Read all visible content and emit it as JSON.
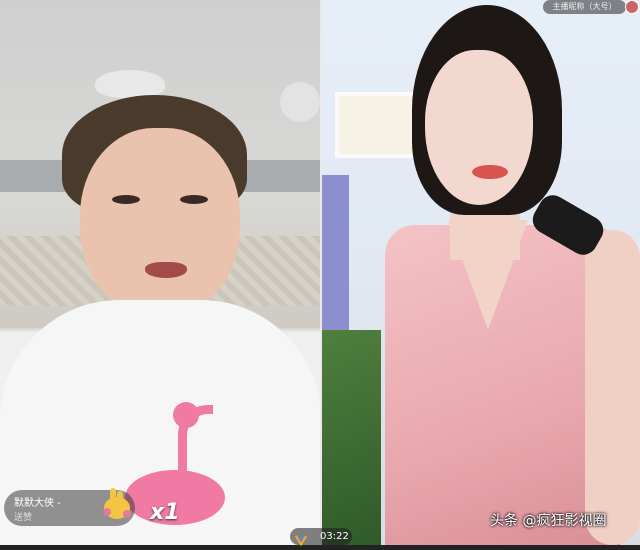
{
  "top_right_tag": "主播昵称（大号）",
  "gift_banner": {
    "username": "默默大侠 -",
    "subtitle": "送赞",
    "gift_icon": "gift-hand-icon",
    "count": "x1"
  },
  "stream_timer": {
    "logo_icon": "app-logo-icon",
    "time": "03:22"
  },
  "watermark": "头条 @疯狂影视圈"
}
